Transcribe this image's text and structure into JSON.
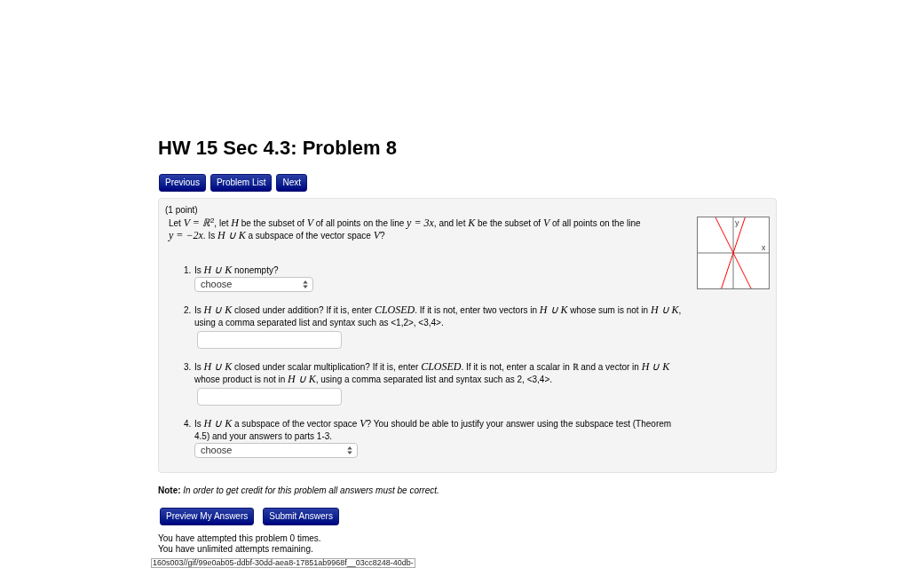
{
  "title": "HW 15 Sec 4.3: Problem 8",
  "nav_buttons": [
    "Previous",
    "Problem List",
    "Next"
  ],
  "problem": {
    "points": "(1 point)",
    "statement": "Let *V = ℝ*$^{2}$, let *H* be the subset of *V* of all points on the line *y = 3x*, and let *K* be the subset of *V* of all points on the line *y = −2x*. Is *H ∪ K* a subspace of the vector space *V*?",
    "graph": {
      "x_label": "x",
      "y_label": "y"
    },
    "questions": [
      {
        "number": "1.",
        "text": "Is *H ∪ K* nonempty?",
        "kind": "dropdown",
        "value": "choose"
      },
      {
        "number": "2.",
        "text": "Is *H ∪ K* closed under addition? If it is, enter *CLOSED*. If it is not, enter two vectors in *H ∪ K* whose sum is not in *H ∪ K*, using a comma separated list and syntax such as <1,2>, <3,4>.",
        "kind": "text"
      },
      {
        "number": "3.",
        "text": "Is *H ∪ K* closed under scalar multiplication? If it is, enter *CLOSED*. If it is not, enter a scalar in ℝ and a vector in *H ∪ K* whose product is not in *H ∪ K*, using a comma separated list and syntax such as 2, <3,4>.",
        "kind": "text"
      },
      {
        "number": "4.",
        "text": "Is *H ∪ K* a subspace of the vector space *V*? You should be able to justify your answer using the subspace test (Theorem 4.5) and your answers to parts 1-3.",
        "kind": "dropdown",
        "value": "choose"
      }
    ]
  },
  "note": "**Note:** *In order to get credit for this problem all answers must be correct.*",
  "action_buttons": [
    "Preview My Answers",
    "Submit Answers"
  ],
  "attempts": [
    "You have attempted this problem 0 times.",
    "You have unlimited attempts remaining."
  ],
  "status_bar": {
    "url": "160s003//gif/99e0ab05-ddbf-30dd-aea8-17851ab9968f__03cc8248-40db-"
  }
}
